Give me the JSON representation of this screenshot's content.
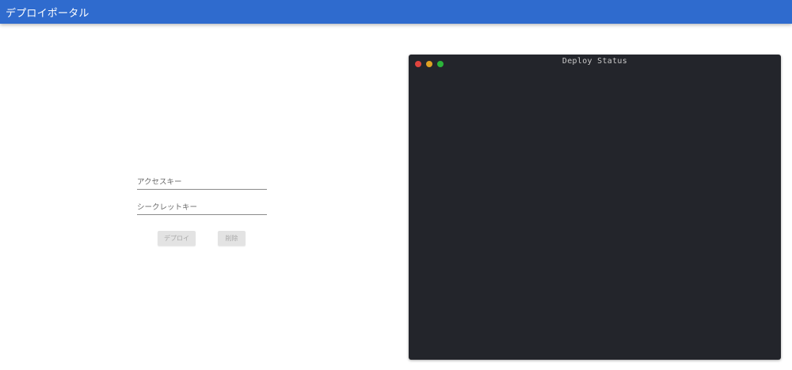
{
  "app_bar": {
    "title": "デプロイポータル"
  },
  "form": {
    "access_key": {
      "placeholder": "アクセスキー",
      "value": ""
    },
    "secret_key": {
      "placeholder": "シークレットキー",
      "value": ""
    },
    "deploy_label": "デプロイ",
    "delete_label": "削除"
  },
  "terminal": {
    "title": "Deploy Status",
    "output": ""
  },
  "colors": {
    "app_bar": "#2f6bce",
    "terminal_bg": "#23252b",
    "dot_red": "#e0443e",
    "dot_yellow": "#dea123",
    "dot_green": "#2bb43a"
  },
  "icons": {
    "close": "window-close-dot-icon",
    "minimize": "window-minimize-dot-icon",
    "maximize": "window-maximize-dot-icon"
  }
}
